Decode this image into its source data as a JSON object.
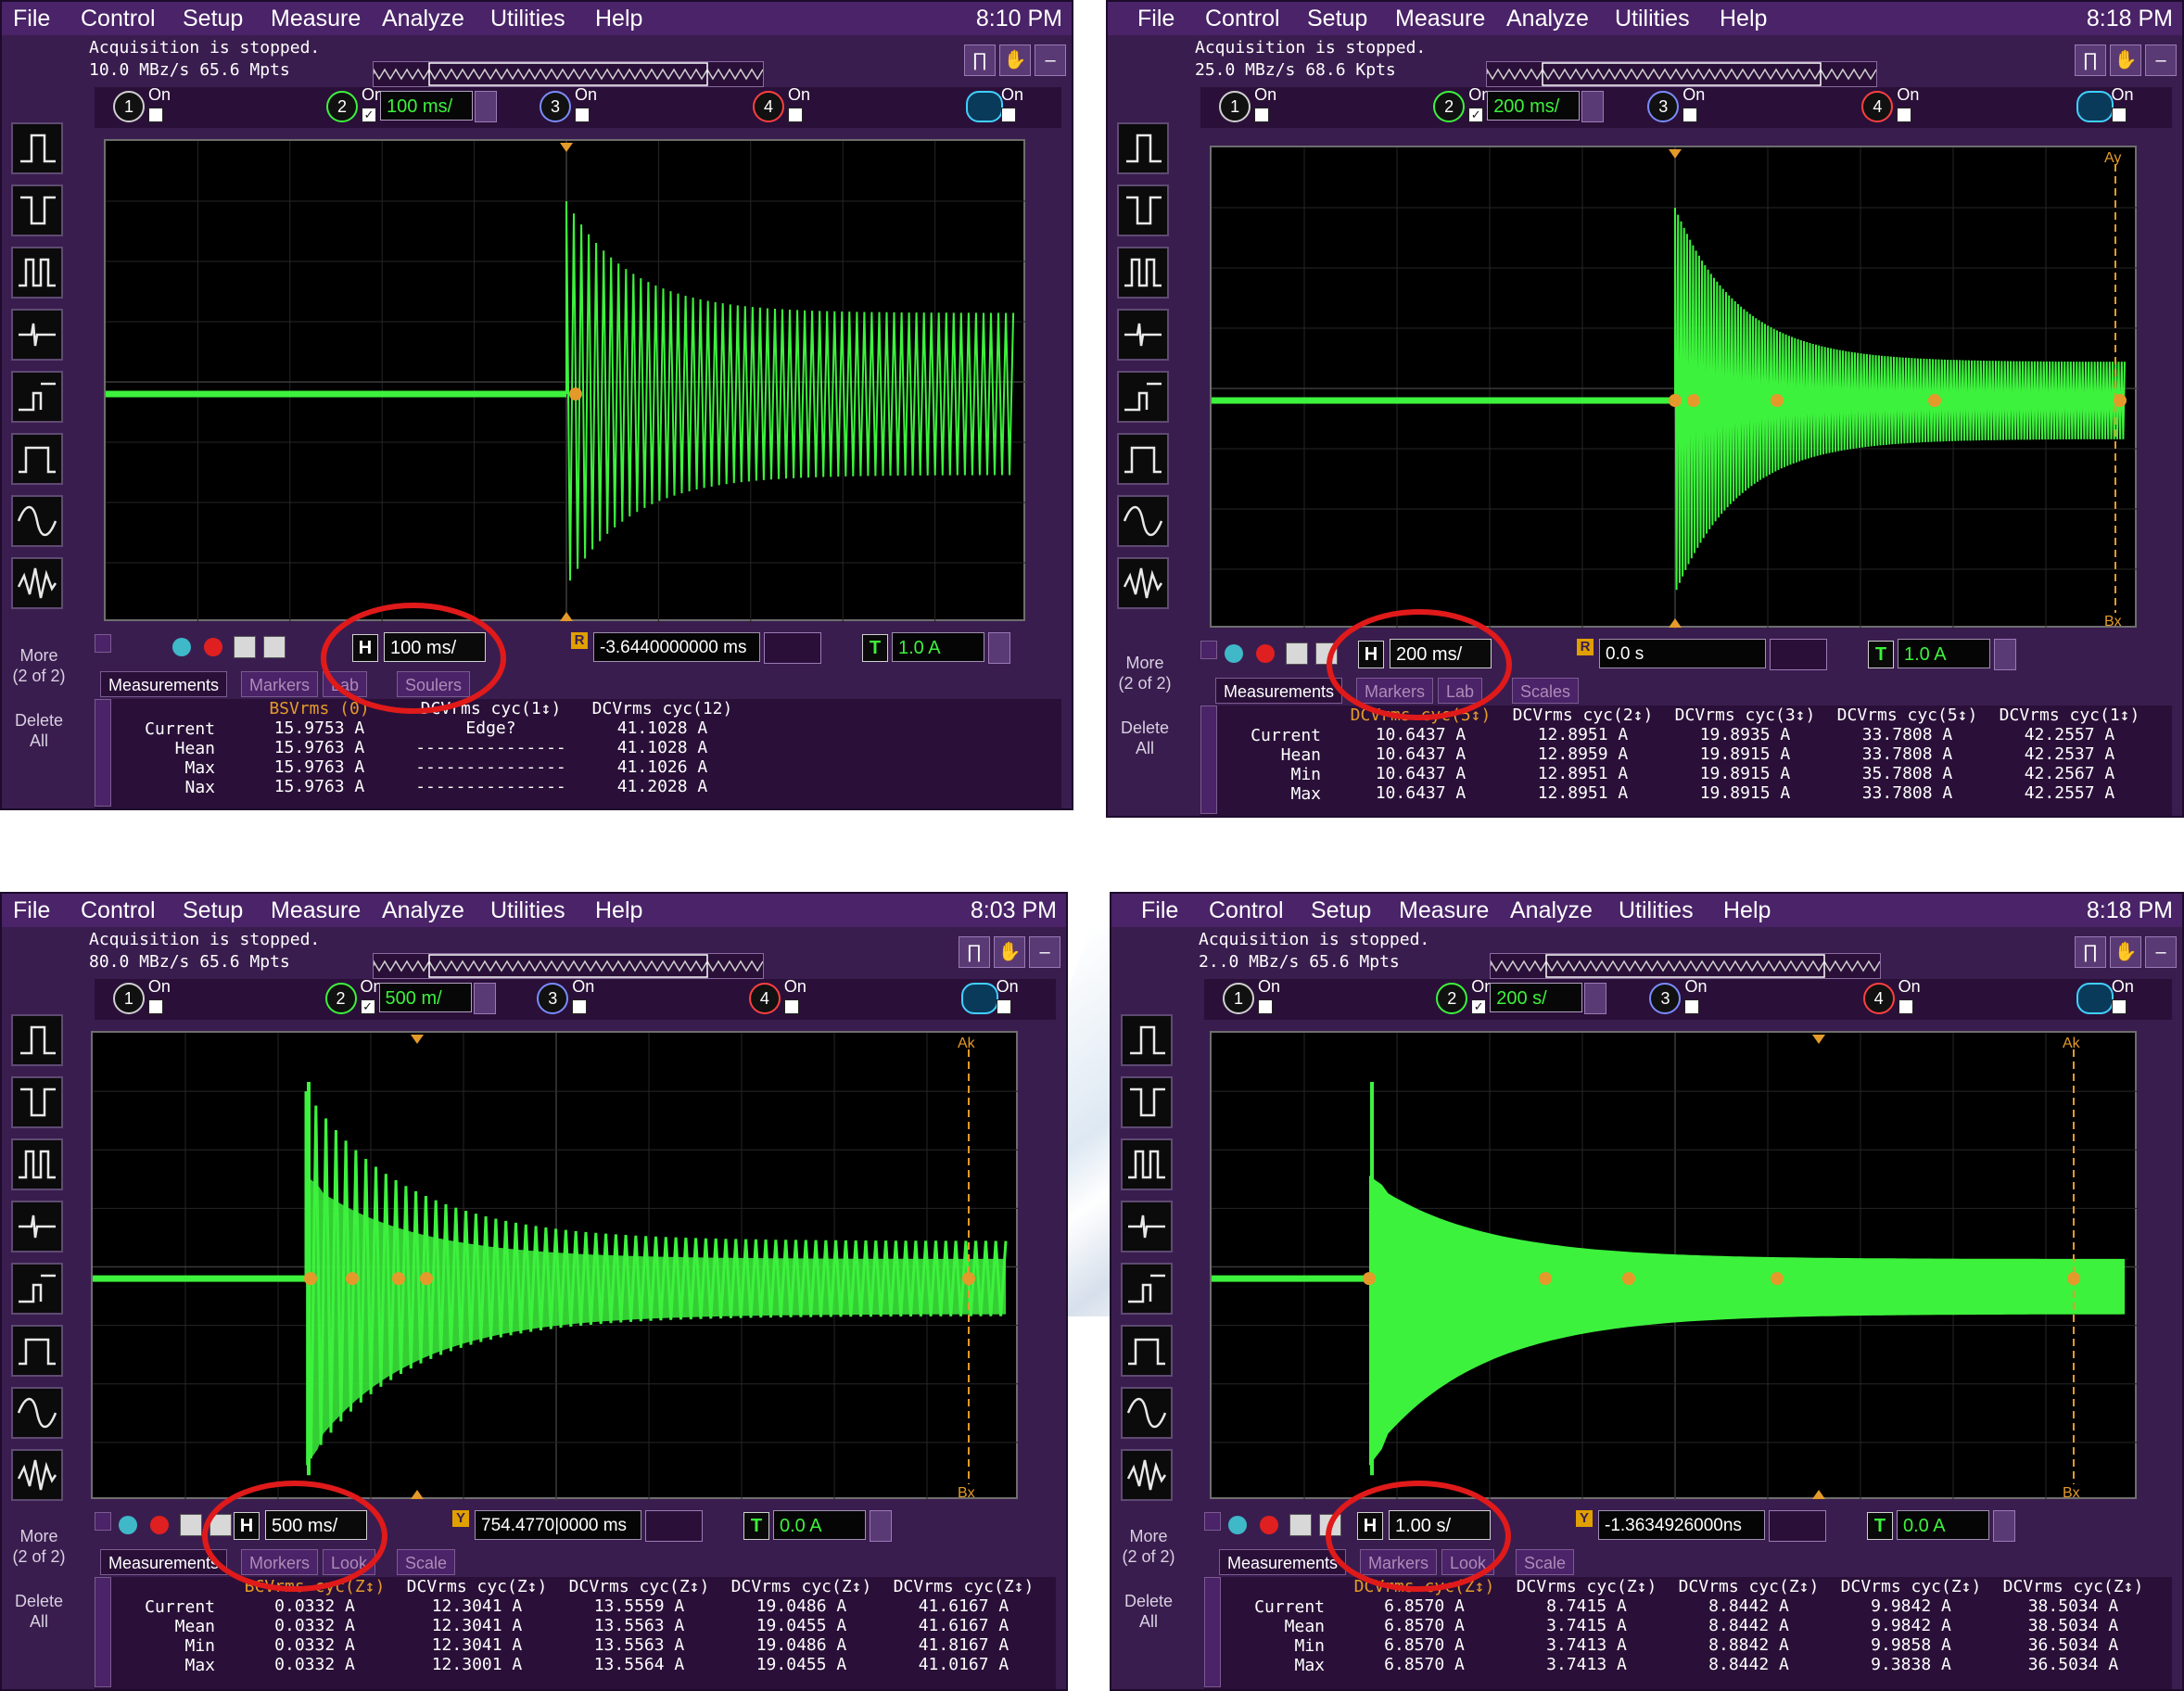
{
  "colors": {
    "panel": "#3a1d4f",
    "menubar": "#4a2368",
    "screen": "#000000",
    "trace": "#3df23d",
    "marker": "#e49a2a",
    "highlight_ring": "#e01a1a"
  },
  "menu": [
    "File",
    "Control",
    "Setup",
    "Measure",
    "Analyze",
    "Utilities",
    "Help"
  ],
  "panels": [
    {
      "clock": "8:10 PM",
      "acq_line1": "Acquisition is stopped.",
      "acq_line2": "10.0 MBz/s   65.6 Mpts",
      "channels": [
        {
          "num": "1",
          "on": "On",
          "value": "",
          "checked": false
        },
        {
          "num": "2",
          "on": "On",
          "value": "100 ms/",
          "checked": true
        },
        {
          "num": "3",
          "on": "On",
          "value": "",
          "checked": false
        },
        {
          "num": "4",
          "on": "On",
          "value": "",
          "checked": false
        },
        {
          "num": "",
          "on": "On",
          "value": "",
          "checked": false
        }
      ],
      "h_label": "H",
      "h_value": "100 ms/",
      "r_label": "R",
      "position": "-3.6440000000 ms",
      "t_label": "T",
      "t_value": "1.0 A",
      "tabs": [
        "Measurements",
        "Markers",
        "Lab",
        "Soulers"
      ],
      "more": "More\n(2 of 2)",
      "delete": "Delete\nAll",
      "meas_headers": [
        "BSVrms (0)",
        "DCVrms cyc(1↕)",
        "DCVrms cyc(12)"
      ],
      "meas_rows": [
        {
          "label": "Current",
          "values": [
            "15.9753 A",
            "Edge?",
            "41.1028 A"
          ]
        },
        {
          "label": "Hean",
          "values": [
            "15.9763 A",
            "---------------",
            "41.1028 A"
          ]
        },
        {
          "label": "Max",
          "values": [
            "15.9763 A",
            "---------------",
            "41.1026 A"
          ]
        },
        {
          "label": "Nax",
          "values": [
            "15.9763 A",
            "---------------",
            "41.2028 A"
          ]
        }
      ]
    },
    {
      "clock": "8:18 PM",
      "acq_line1": "Acquisition is stopped.",
      "acq_line2": "25.0 MBz/s   68.6 Kpts",
      "channels": [
        {
          "num": "1",
          "on": "On",
          "value": "",
          "checked": false
        },
        {
          "num": "2",
          "on": "On",
          "value": "200 ms/",
          "checked": true
        },
        {
          "num": "3",
          "on": "On",
          "value": "",
          "checked": false
        },
        {
          "num": "4",
          "on": "On",
          "value": "",
          "checked": false
        },
        {
          "num": "",
          "on": "On",
          "value": "",
          "checked": false
        }
      ],
      "h_label": "H",
      "h_value": "200 ms/",
      "r_label": "R",
      "position": "0.0 s",
      "t_label": "T",
      "t_value": "1.0 A",
      "tabs": [
        "Measurements",
        "Markers",
        "Lab",
        "Scales"
      ],
      "more": "More\n(2 of 2)",
      "delete": "Delete\nAll",
      "marker_top": "Ay",
      "marker_bottom": "Bx",
      "meas_headers": [
        "DCVrms cyc(5↕)",
        "DCVrms cyc(2↕)",
        "DCVrms cyc(3↕)",
        "DCVrms cyc(5↕)",
        "DCVrms cyc(1↕)"
      ],
      "meas_rows": [
        {
          "label": "Current",
          "values": [
            "10.6437 A",
            "12.8951 A",
            "19.8935 A",
            "33.7808 A",
            "42.2557 A"
          ]
        },
        {
          "label": "Hean",
          "values": [
            "10.6437 A",
            "12.8959 A",
            "19.8915 A",
            "33.7808 A",
            "42.2537 A"
          ]
        },
        {
          "label": "Min",
          "values": [
            "10.6437 A",
            "12.8951 A",
            "19.8915 A",
            "35.7808 A",
            "42.2567 A"
          ]
        },
        {
          "label": "Max",
          "values": [
            "10.6437 A",
            "12.8951 A",
            "19.8915 A",
            "33.7808 A",
            "42.2557 A"
          ]
        }
      ]
    },
    {
      "clock": "8:03 PM",
      "acq_line1": "Acquisition is stopped.",
      "acq_line2": "80.0 MBz/s   65.6 Mpts",
      "channels": [
        {
          "num": "1",
          "on": "On",
          "value": "",
          "checked": false
        },
        {
          "num": "2",
          "on": "On",
          "value": "500 m/",
          "checked": true
        },
        {
          "num": "3",
          "on": "On",
          "value": "",
          "checked": false
        },
        {
          "num": "4",
          "on": "On",
          "value": "",
          "checked": false
        },
        {
          "num": "",
          "on": "On",
          "value": "",
          "checked": false
        }
      ],
      "h_label": "H",
      "h_value": "500 ms/",
      "r_label": "Y",
      "position": "754.4770|0000 ms",
      "t_label": "T",
      "t_value": "0.0 A",
      "tabs": [
        "Measurements",
        "Morkers",
        "Look",
        "Scale"
      ],
      "more": "More\n(2 of 2)",
      "delete": "Delete\nAll",
      "marker_top": "Ak",
      "marker_bottom": "Bx",
      "meas_headers": [
        "BCVrms cyc(Z↕)",
        "DCVrms cyc(Z↕)",
        "DCVrms cyc(Z↕)",
        "DCVrms cyc(Z↕)",
        "DCVrms cyc(Z↕)"
      ],
      "meas_rows": [
        {
          "label": "Current",
          "values": [
            "0.0332 A",
            "12.3041 A",
            "13.5559 A",
            "19.0486 A",
            "41.6167 A"
          ]
        },
        {
          "label": "Mean",
          "values": [
            "0.0332 A",
            "12.3041 A",
            "13.5563 A",
            "19.0455 A",
            "41.6167 A"
          ]
        },
        {
          "label": "Min",
          "values": [
            "0.0332 A",
            "12.3041 A",
            "13.5563 A",
            "19.0486 A",
            "41.8167 A"
          ]
        },
        {
          "label": "Max",
          "values": [
            "0.0332 A",
            "12.3001 A",
            "13.5564 A",
            "19.0455 A",
            "41.0167 A"
          ]
        }
      ]
    },
    {
      "clock": "8:18 PM",
      "acq_line1": "Acquisition is stopped.",
      "acq_line2": "2..0 MBz/s   65.6 Mpts",
      "channels": [
        {
          "num": "1",
          "on": "On",
          "value": "",
          "checked": false
        },
        {
          "num": "2",
          "on": "On",
          "value": "200 s/",
          "checked": true
        },
        {
          "num": "3",
          "on": "On",
          "value": "",
          "checked": false
        },
        {
          "num": "4",
          "on": "On",
          "value": "",
          "checked": false
        },
        {
          "num": "",
          "on": "On",
          "value": "",
          "checked": false
        }
      ],
      "h_label": "H",
      "h_value": "1.00 s/",
      "r_label": "Y",
      "position": "-1.3634926000ns",
      "t_label": "T",
      "t_value": "0.0 A",
      "tabs": [
        "Measurements",
        "Markers",
        "Look",
        "Scale"
      ],
      "more": "More\n(2 of 2)",
      "delete": "Delete\nAll",
      "marker_top": "Ak",
      "marker_bottom": "Bx",
      "meas_headers": [
        "DCVrms cyc(Z↕)",
        "DCVrms cyc(Z↕)",
        "DCVrms cyc(Z↕)",
        "DCVrms cyc(Z↕)",
        "DCVrms cyc(Z↕)"
      ],
      "meas_rows": [
        {
          "label": "Current",
          "values": [
            "6.8570 A",
            "8.7415 A",
            "8.8442 A",
            "9.9842 A",
            "38.5034 A"
          ]
        },
        {
          "label": "Mean",
          "values": [
            "6.8570 A",
            "3.7415 A",
            "8.8442 A",
            "9.9842 A",
            "38.5034 A"
          ]
        },
        {
          "label": "Min",
          "values": [
            "6.8570 A",
            "3.7413 A",
            "8.8842 A",
            "9.9858 A",
            "36.5034 A"
          ]
        },
        {
          "label": "Max",
          "values": [
            "6.8570 A",
            "3.7413 A",
            "8.8442 A",
            "9.3838 A",
            "36.5034 A"
          ]
        }
      ]
    }
  ]
}
